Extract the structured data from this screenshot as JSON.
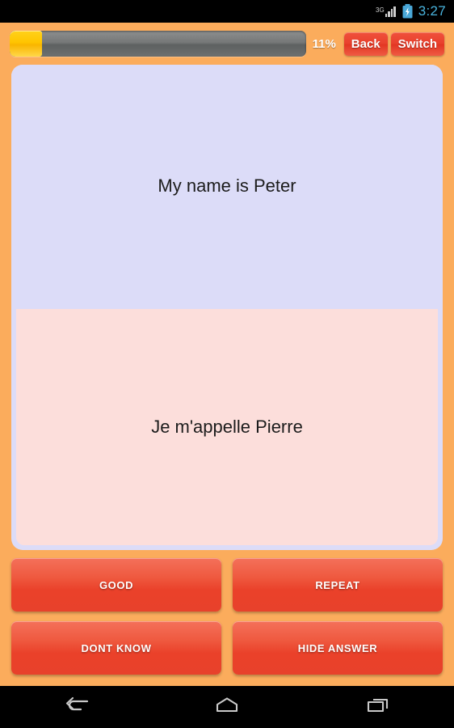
{
  "status_bar": {
    "network_label": "3G",
    "signal_icon": "signal-bars-icon",
    "battery_icon": "battery-charging-icon",
    "clock": "3:27"
  },
  "toolbar": {
    "progress_icon": "progress-bar",
    "progress_percent_value": 11,
    "progress_percent_label": "11%",
    "back_label": "Back",
    "switch_label": "Switch"
  },
  "card": {
    "question_text": "My name is Peter",
    "answer_text": "Je m'appelle Pierre",
    "question_bg": "#dcdcf8",
    "answer_bg": "#fcdedb"
  },
  "actions": [
    {
      "label": "GOOD",
      "name": "good-button"
    },
    {
      "label": "REPEAT",
      "name": "repeat-button"
    },
    {
      "label": "DONT KNOW",
      "name": "dont-know-button"
    },
    {
      "label": "HIDE ANSWER",
      "name": "hide-answer-button"
    }
  ],
  "nav_bar": {
    "back_icon": "back-arrow-icon",
    "home_icon": "home-icon",
    "recents_icon": "recent-apps-icon"
  },
  "colors": {
    "background": "#FBAC5C",
    "accent_red": "#e8412b",
    "progress_fill": "#ffc400",
    "clock_blue": "#49b3dd"
  }
}
